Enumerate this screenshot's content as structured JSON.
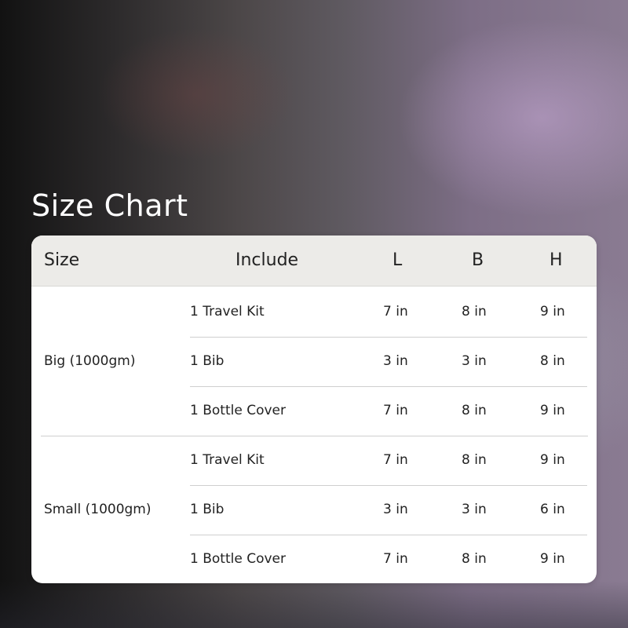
{
  "title": "Size Chart",
  "table": {
    "headers": [
      "Size",
      "Include",
      "L",
      "B",
      "H"
    ],
    "groups": [
      {
        "size": "Big (1000gm)",
        "rows": [
          {
            "include": "1 Travel Kit",
            "l": "7 in",
            "b": "8 in",
            "h": "9 in"
          },
          {
            "include": "1 Bib",
            "l": "3 in",
            "b": "3 in",
            "h": "8 in"
          },
          {
            "include": "1 Bottle Cover",
            "l": "7 in",
            "b": "8 in",
            "h": "9 in"
          }
        ]
      },
      {
        "size": "Small (1000gm)",
        "rows": [
          {
            "include": "1 Travel Kit",
            "l": "7 in",
            "b": "8 in",
            "h": "9 in"
          },
          {
            "include": "1 Bib",
            "l": "3 in",
            "b": "3 in",
            "h": "6 in"
          },
          {
            "include": "1 Bottle Cover",
            "l": "7 in",
            "b": "8 in",
            "h": "9 in"
          }
        ]
      }
    ]
  }
}
